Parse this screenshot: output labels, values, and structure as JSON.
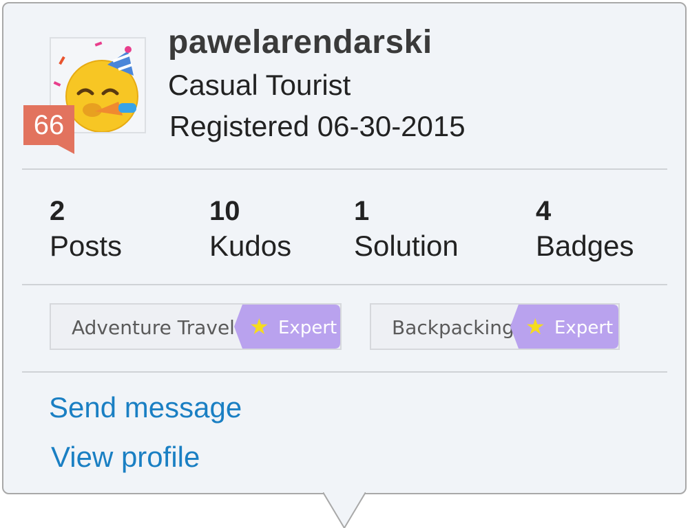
{
  "profile": {
    "username": "pawelarendarski",
    "rank_title": "Casual Tourist",
    "registered": "Registered 06-30-2015",
    "rank_number": "66",
    "avatar_icon": "party-face-emoji-icon"
  },
  "stats": [
    {
      "value": "2",
      "label": "Posts"
    },
    {
      "value": "10",
      "label": "Kudos"
    },
    {
      "value": "1",
      "label": "Solution"
    },
    {
      "value": "4",
      "label": "Badges"
    }
  ],
  "expertise": [
    {
      "topic": "Adventure Travel",
      "level": "Expert",
      "icon": "star-icon"
    },
    {
      "topic": "Backpacking",
      "level": "Expert",
      "icon": "star-icon"
    }
  ],
  "actions": {
    "send_message": "Send message",
    "view_profile": "View profile"
  },
  "colors": {
    "card_background": "#f1f4f8",
    "rank_badge": "#e2735e",
    "expert_tag": "#b9a2ee",
    "star": "#f5dc1e",
    "link": "#1a7fc3"
  }
}
